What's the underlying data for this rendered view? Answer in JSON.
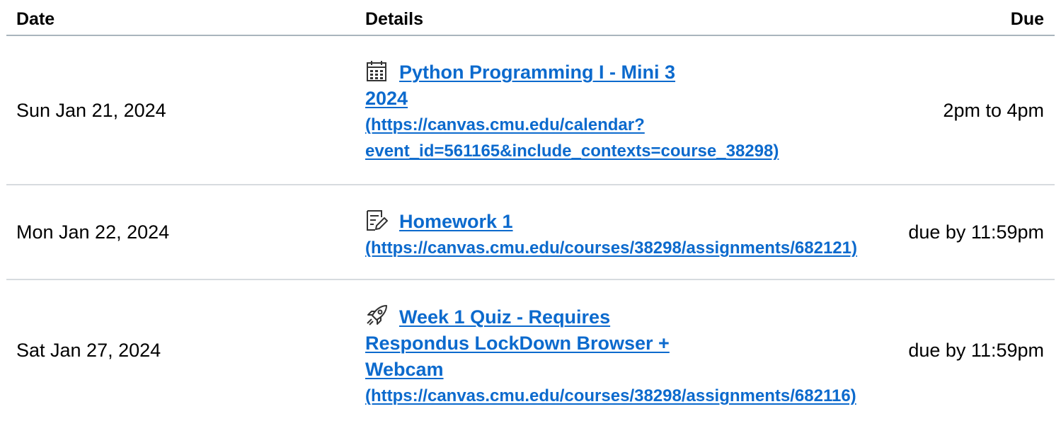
{
  "table": {
    "headers": {
      "date": "Date",
      "details": "Details",
      "due": "Due"
    },
    "rows": [
      {
        "date": "Sun Jan 21, 2024",
        "icon": "calendar-icon",
        "title": "Python Programming I - Mini 3 2024",
        "url_text_1": "(https://canvas.cmu.edu/calendar?",
        "url_text_2": "event_id=561165&include_contexts=course_38298)",
        "due": "2pm to 4pm"
      },
      {
        "date": "Mon Jan 22, 2024",
        "icon": "assignment-icon",
        "title": "Homework 1",
        "url_text": "(https://canvas.cmu.edu/courses/38298/assignments/682121)",
        "due": "due by 11:59pm"
      },
      {
        "date": "Sat Jan 27, 2024",
        "icon": "quiz-rocket-icon",
        "title": "Week 1 Quiz - Requires Respondus LockDown Browser + Webcam",
        "url_text": "(https://canvas.cmu.edu/courses/38298/assignments/682116)",
        "due": "due by 11:59pm"
      }
    ]
  },
  "colors": {
    "link": "#0c6acd",
    "header_border": "#a9b5bd",
    "row_border": "#d7dbdf"
  }
}
